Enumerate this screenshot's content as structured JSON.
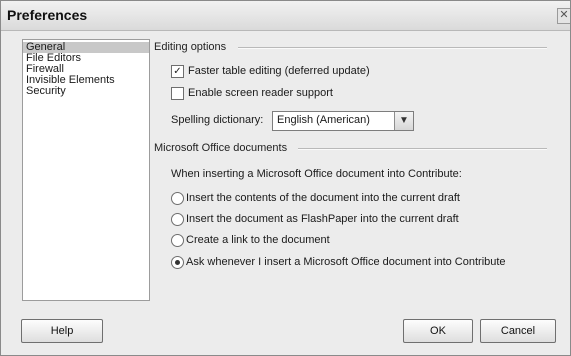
{
  "window": {
    "title": "Preferences",
    "close_icon": "close-icon"
  },
  "categories": [
    {
      "label": "General",
      "selected": true
    },
    {
      "label": "File Editors",
      "selected": false
    },
    {
      "label": "Firewall",
      "selected": false
    },
    {
      "label": "Invisible Elements",
      "selected": false
    },
    {
      "label": "Security",
      "selected": false
    }
  ],
  "editing": {
    "heading": "Editing options",
    "faster_table": {
      "label": "Faster table editing (deferred update)",
      "checked": true
    },
    "screen_reader": {
      "label": "Enable screen reader support",
      "checked": false
    },
    "spelling": {
      "label": "Spelling dictionary:",
      "value": "English (American)"
    }
  },
  "office": {
    "heading": "Microsoft Office documents",
    "prompt": "When inserting a Microsoft Office document into Contribute:",
    "options": [
      {
        "label": "Insert the contents of the document into the current draft",
        "selected": false
      },
      {
        "label": "Insert the document as FlashPaper into the current draft",
        "selected": false
      },
      {
        "label": "Create a link to the document",
        "selected": false
      },
      {
        "label": "Ask whenever I insert a Microsoft Office document into Contribute",
        "selected": true
      }
    ]
  },
  "buttons": {
    "help": "Help",
    "ok": "OK",
    "cancel": "Cancel"
  }
}
